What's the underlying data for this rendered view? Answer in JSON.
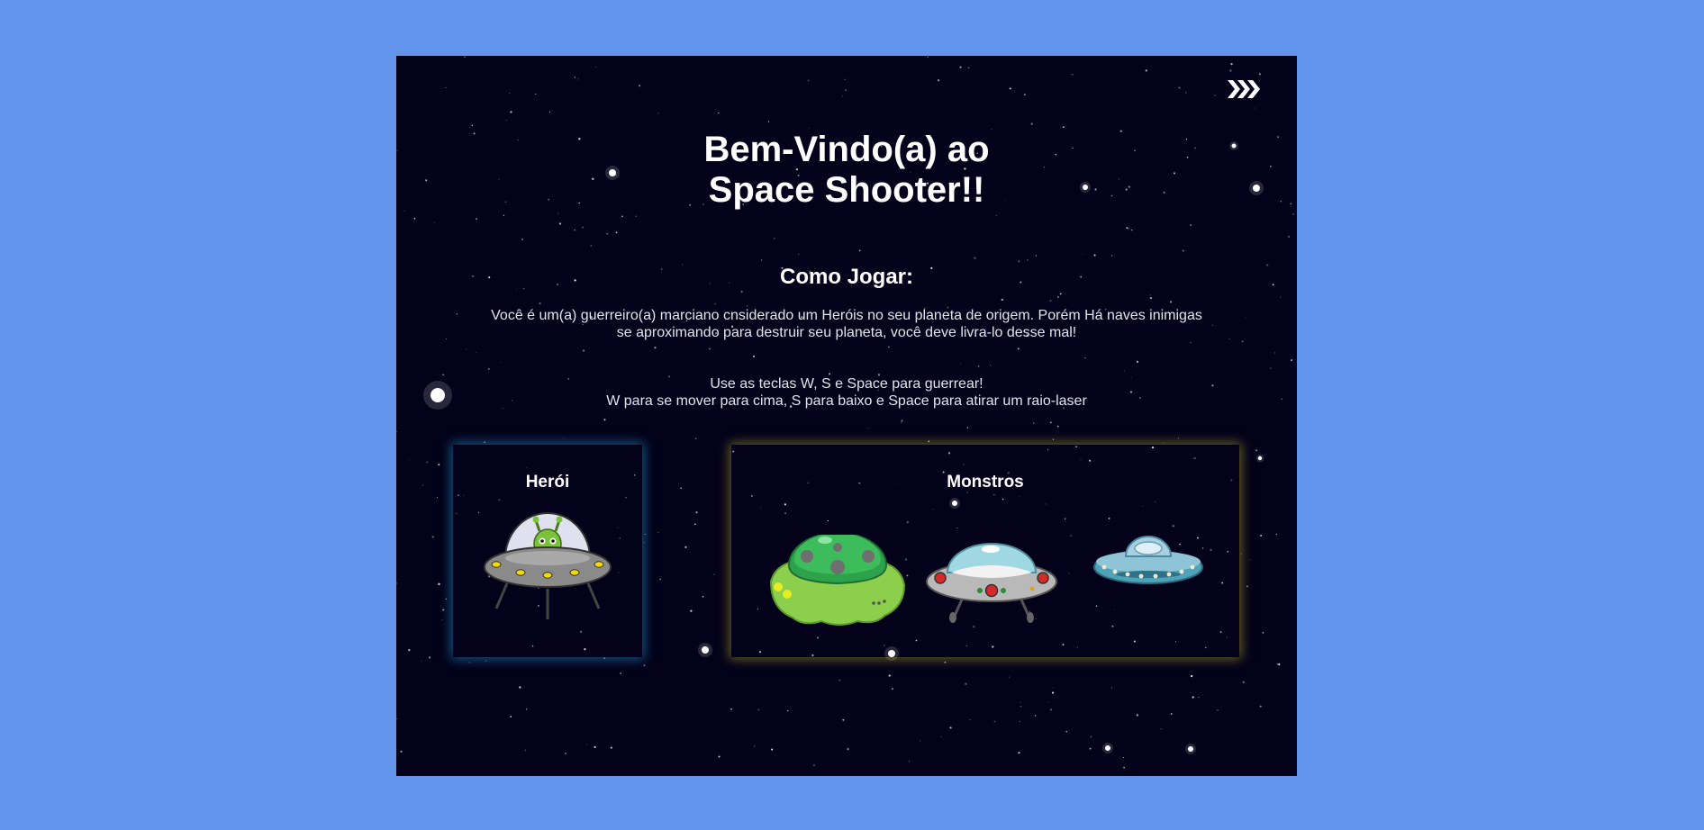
{
  "title": {
    "line1": "Bem-Vindo(a) ao",
    "line2": "Space Shooter!!"
  },
  "how_to": {
    "heading": "Como Jogar:",
    "intro_line1": "Você é um(a) guerreiro(a) marciano cnsiderado um Heróis no seu planeta de origem. Porém Há naves inimigas",
    "intro_line2": "se aproximando para destruir seu planeta, você deve livra-lo desse mal!",
    "controls_line1": "Use as teclas W, S e Space para guerrear!",
    "controls_line2": "W para se mover para cima, S para baixo e Space para atirar um raio-laser"
  },
  "hero_panel": {
    "title": "Herói",
    "sprite": "alien-ufo-icon"
  },
  "monsters_panel": {
    "title": "Monstros",
    "sprites": [
      "green-ufo-icon",
      "silver-ufo-icon",
      "teal-ufo-icon"
    ]
  },
  "navigation": {
    "next_icon": "fast-forward-chevrons-icon"
  },
  "colors": {
    "page_background": "#6495ed",
    "game_background": "#03021a",
    "hero_glow": "#1e78aa",
    "monsters_glow": "#968c28",
    "text": "#ffffff"
  }
}
